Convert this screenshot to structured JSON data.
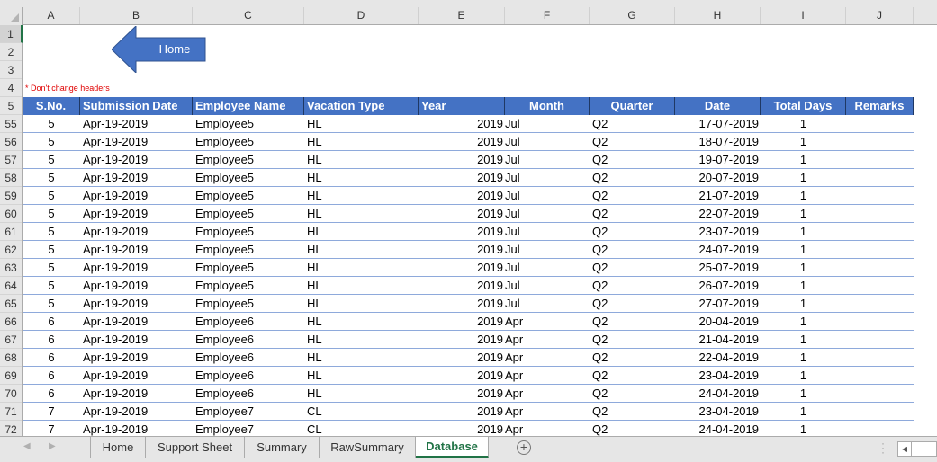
{
  "columns": [
    "A",
    "B",
    "C",
    "D",
    "E",
    "F",
    "G",
    "H",
    "I",
    "J"
  ],
  "top_rows": [
    "1",
    "2",
    "3",
    "4",
    "5"
  ],
  "home_button": {
    "label": "Home",
    "color": "#4472c4"
  },
  "note": "* Don't change headers",
  "headers": [
    "S.No.",
    "Submission Date",
    "Employee Name",
    "Vacation Type",
    "Year",
    "Month",
    "Quarter",
    "Date",
    "Total Days",
    "Remarks"
  ],
  "rows": [
    {
      "row": "55",
      "sno": "5",
      "submission": "Apr-19-2019",
      "employee": "Employee5",
      "type": "HL",
      "year": "2019",
      "month": "Jul",
      "quarter": "Q2",
      "date": "17-07-2019",
      "days": "1",
      "remarks": ""
    },
    {
      "row": "56",
      "sno": "5",
      "submission": "Apr-19-2019",
      "employee": "Employee5",
      "type": "HL",
      "year": "2019",
      "month": "Jul",
      "quarter": "Q2",
      "date": "18-07-2019",
      "days": "1",
      "remarks": ""
    },
    {
      "row": "57",
      "sno": "5",
      "submission": "Apr-19-2019",
      "employee": "Employee5",
      "type": "HL",
      "year": "2019",
      "month": "Jul",
      "quarter": "Q2",
      "date": "19-07-2019",
      "days": "1",
      "remarks": ""
    },
    {
      "row": "58",
      "sno": "5",
      "submission": "Apr-19-2019",
      "employee": "Employee5",
      "type": "HL",
      "year": "2019",
      "month": "Jul",
      "quarter": "Q2",
      "date": "20-07-2019",
      "days": "1",
      "remarks": ""
    },
    {
      "row": "59",
      "sno": "5",
      "submission": "Apr-19-2019",
      "employee": "Employee5",
      "type": "HL",
      "year": "2019",
      "month": "Jul",
      "quarter": "Q2",
      "date": "21-07-2019",
      "days": "1",
      "remarks": ""
    },
    {
      "row": "60",
      "sno": "5",
      "submission": "Apr-19-2019",
      "employee": "Employee5",
      "type": "HL",
      "year": "2019",
      "month": "Jul",
      "quarter": "Q2",
      "date": "22-07-2019",
      "days": "1",
      "remarks": ""
    },
    {
      "row": "61",
      "sno": "5",
      "submission": "Apr-19-2019",
      "employee": "Employee5",
      "type": "HL",
      "year": "2019",
      "month": "Jul",
      "quarter": "Q2",
      "date": "23-07-2019",
      "days": "1",
      "remarks": ""
    },
    {
      "row": "62",
      "sno": "5",
      "submission": "Apr-19-2019",
      "employee": "Employee5",
      "type": "HL",
      "year": "2019",
      "month": "Jul",
      "quarter": "Q2",
      "date": "24-07-2019",
      "days": "1",
      "remarks": ""
    },
    {
      "row": "63",
      "sno": "5",
      "submission": "Apr-19-2019",
      "employee": "Employee5",
      "type": "HL",
      "year": "2019",
      "month": "Jul",
      "quarter": "Q2",
      "date": "25-07-2019",
      "days": "1",
      "remarks": ""
    },
    {
      "row": "64",
      "sno": "5",
      "submission": "Apr-19-2019",
      "employee": "Employee5",
      "type": "HL",
      "year": "2019",
      "month": "Jul",
      "quarter": "Q2",
      "date": "26-07-2019",
      "days": "1",
      "remarks": ""
    },
    {
      "row": "65",
      "sno": "5",
      "submission": "Apr-19-2019",
      "employee": "Employee5",
      "type": "HL",
      "year": "2019",
      "month": "Jul",
      "quarter": "Q2",
      "date": "27-07-2019",
      "days": "1",
      "remarks": ""
    },
    {
      "row": "66",
      "sno": "6",
      "submission": "Apr-19-2019",
      "employee": "Employee6",
      "type": "HL",
      "year": "2019",
      "month": "Apr",
      "quarter": "Q2",
      "date": "20-04-2019",
      "days": "1",
      "remarks": ""
    },
    {
      "row": "67",
      "sno": "6",
      "submission": "Apr-19-2019",
      "employee": "Employee6",
      "type": "HL",
      "year": "2019",
      "month": "Apr",
      "quarter": "Q2",
      "date": "21-04-2019",
      "days": "1",
      "remarks": ""
    },
    {
      "row": "68",
      "sno": "6",
      "submission": "Apr-19-2019",
      "employee": "Employee6",
      "type": "HL",
      "year": "2019",
      "month": "Apr",
      "quarter": "Q2",
      "date": "22-04-2019",
      "days": "1",
      "remarks": ""
    },
    {
      "row": "69",
      "sno": "6",
      "submission": "Apr-19-2019",
      "employee": "Employee6",
      "type": "HL",
      "year": "2019",
      "month": "Apr",
      "quarter": "Q2",
      "date": "23-04-2019",
      "days": "1",
      "remarks": ""
    },
    {
      "row": "70",
      "sno": "6",
      "submission": "Apr-19-2019",
      "employee": "Employee6",
      "type": "HL",
      "year": "2019",
      "month": "Apr",
      "quarter": "Q2",
      "date": "24-04-2019",
      "days": "1",
      "remarks": ""
    },
    {
      "row": "71",
      "sno": "7",
      "submission": "Apr-19-2019",
      "employee": "Employee7",
      "type": "CL",
      "year": "2019",
      "month": "Apr",
      "quarter": "Q2",
      "date": "23-04-2019",
      "days": "1",
      "remarks": ""
    },
    {
      "row": "72",
      "sno": "7",
      "submission": "Apr-19-2019",
      "employee": "Employee7",
      "type": "CL",
      "year": "2019",
      "month": "Apr",
      "quarter": "Q2",
      "date": "24-04-2019",
      "days": "1",
      "remarks": ""
    }
  ],
  "tabs": [
    {
      "label": "Home",
      "active": false
    },
    {
      "label": "Support Sheet",
      "active": false
    },
    {
      "label": "Summary",
      "active": false
    },
    {
      "label": "RawSummary",
      "active": false
    },
    {
      "label": "Database",
      "active": true
    }
  ],
  "colors": {
    "header_fill": "#4472c4",
    "accent": "#217346",
    "note": "#e00000",
    "row_border": "#8ea9db"
  }
}
